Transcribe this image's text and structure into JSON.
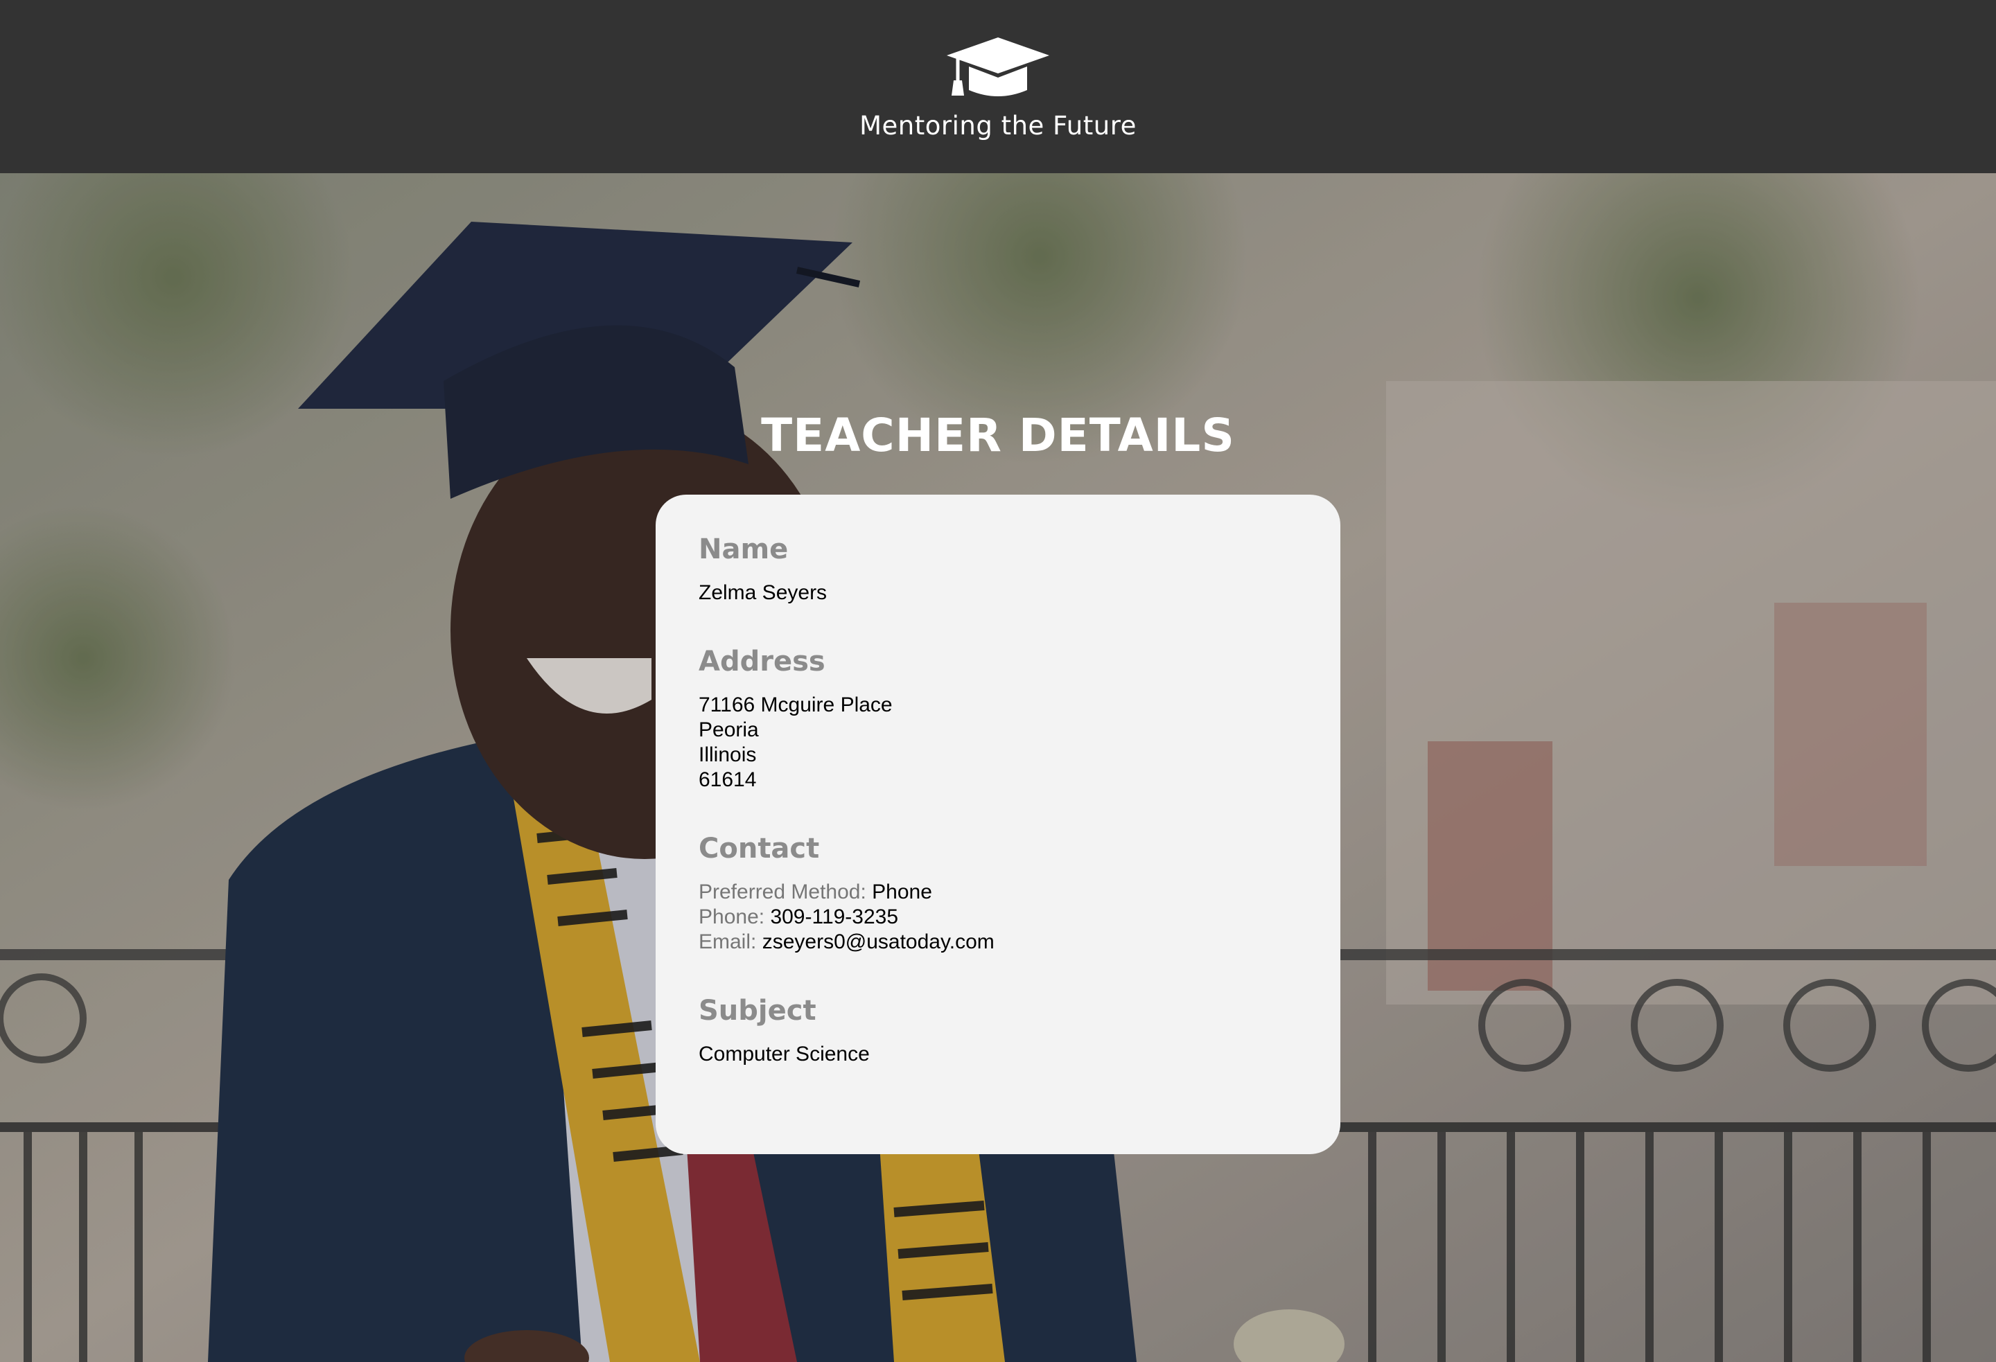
{
  "header": {
    "brand": "Mentoring the Future",
    "logo_icon": "graduation-cap-icon"
  },
  "page": {
    "title": "TEACHER DETAILS"
  },
  "teacher": {
    "name_heading": "Name",
    "name": "Zelma Seyers",
    "address_heading": "Address",
    "address": {
      "street": "71166 Mcguire Place",
      "city": "Peoria",
      "state": "Illinois",
      "zip": "61614"
    },
    "contact_heading": "Contact",
    "contact": {
      "preferred_label": "Preferred Method:",
      "preferred_value": "Phone",
      "phone_label": "Phone:",
      "phone_value": "309-119-3235",
      "email_label": "Email:",
      "email_value": "zseyers0@usatoday.com"
    },
    "subject_heading": "Subject",
    "subject": "Computer Science"
  },
  "colors": {
    "header_bg": "#333333",
    "card_bg": "#f3f3f3",
    "heading_gray": "#8b8b8b",
    "label_gray": "#767676",
    "text": "#000000"
  }
}
